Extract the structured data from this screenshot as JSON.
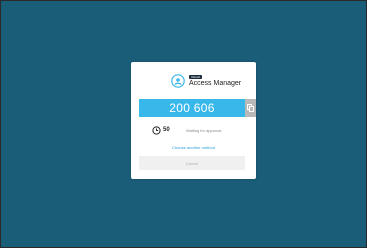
{
  "app": {
    "badge": "Ubisoft",
    "title": "Access Manager"
  },
  "auth": {
    "code": "200 606",
    "timer_value": "50",
    "status_text": "Waiting for approval",
    "other_method_link": "Choose another method",
    "cancel_label": "Cancel"
  },
  "colors": {
    "background": "#1a5d78",
    "code_bar": "#38b7ea",
    "copy_button": "#b8b8b8",
    "link": "#2a9fd6"
  }
}
